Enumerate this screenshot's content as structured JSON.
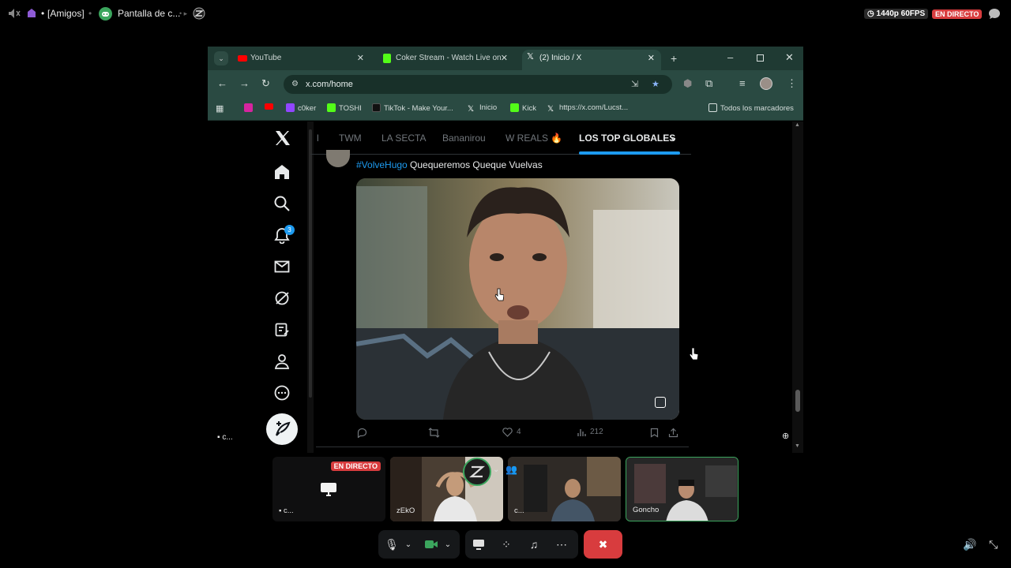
{
  "discord": {
    "channel": "[Amigos]",
    "stream_title": "Pantalla de c...",
    "quality": "1440p 60FPS",
    "live_badge": "EN DIRECTO",
    "tiles": [
      {
        "label": "c...",
        "badge": "EN DIRECTO"
      },
      {
        "label": "zEkO"
      },
      {
        "label": "c..."
      },
      {
        "label": "Goncho"
      }
    ],
    "share_label": "c..."
  },
  "browser": {
    "tabs": [
      {
        "title": "YouTube",
        "active": false
      },
      {
        "title": "Coker Stream - Watch Live on",
        "active": false
      },
      {
        "title": "(2) Inicio / X",
        "active": true
      }
    ],
    "url": "x.com/home",
    "bookmarks": [
      "c0ker",
      "TOSHI",
      "TikTok - Make Your...",
      "Inicio",
      "Kick",
      "https://x.com/Lucst..."
    ],
    "all_bookmarks": "Todos los marcadores"
  },
  "x": {
    "notification_count": "3",
    "feed_tabs": [
      "l",
      "TWM",
      "LA SECTA",
      "Bananirou",
      "W REALS 🔥",
      "LOS TOP GLOBALES"
    ],
    "post": {
      "hashtag": "#VolveHugo",
      "text": " Quequeremos Queque Vuelvas",
      "likes": "4",
      "views": "212"
    }
  },
  "colors": {
    "chrome_tabstrip": "#1f3a33",
    "chrome_toolbar": "#2a4a42",
    "discord_red": "#d83c3e",
    "x_blue": "#1d9bf0"
  }
}
